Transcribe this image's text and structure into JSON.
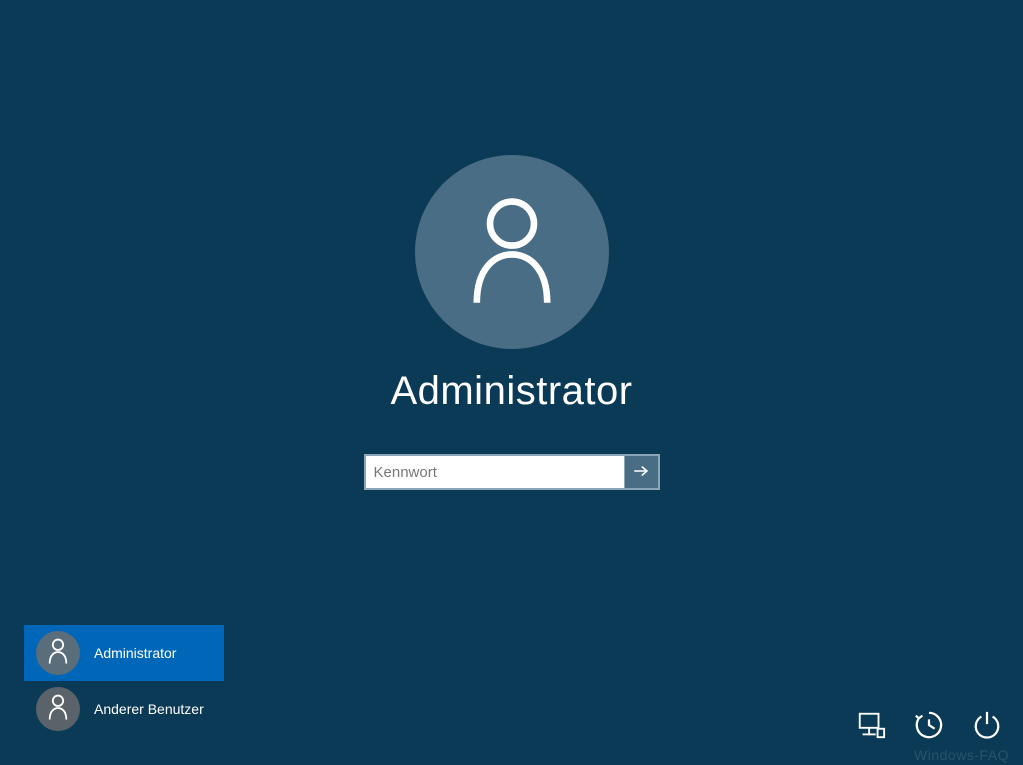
{
  "selected_user": {
    "name": "Administrator"
  },
  "password_field": {
    "placeholder": "Kennwort",
    "value": ""
  },
  "user_list": [
    {
      "name": "Administrator",
      "selected": true
    },
    {
      "name": "Anderer Benutzer",
      "selected": false
    }
  ],
  "watermark": "Windows-FAQ",
  "colors": {
    "background": "#0b3a56",
    "accent": "#0067b8",
    "avatar_bg": "#486d84"
  }
}
